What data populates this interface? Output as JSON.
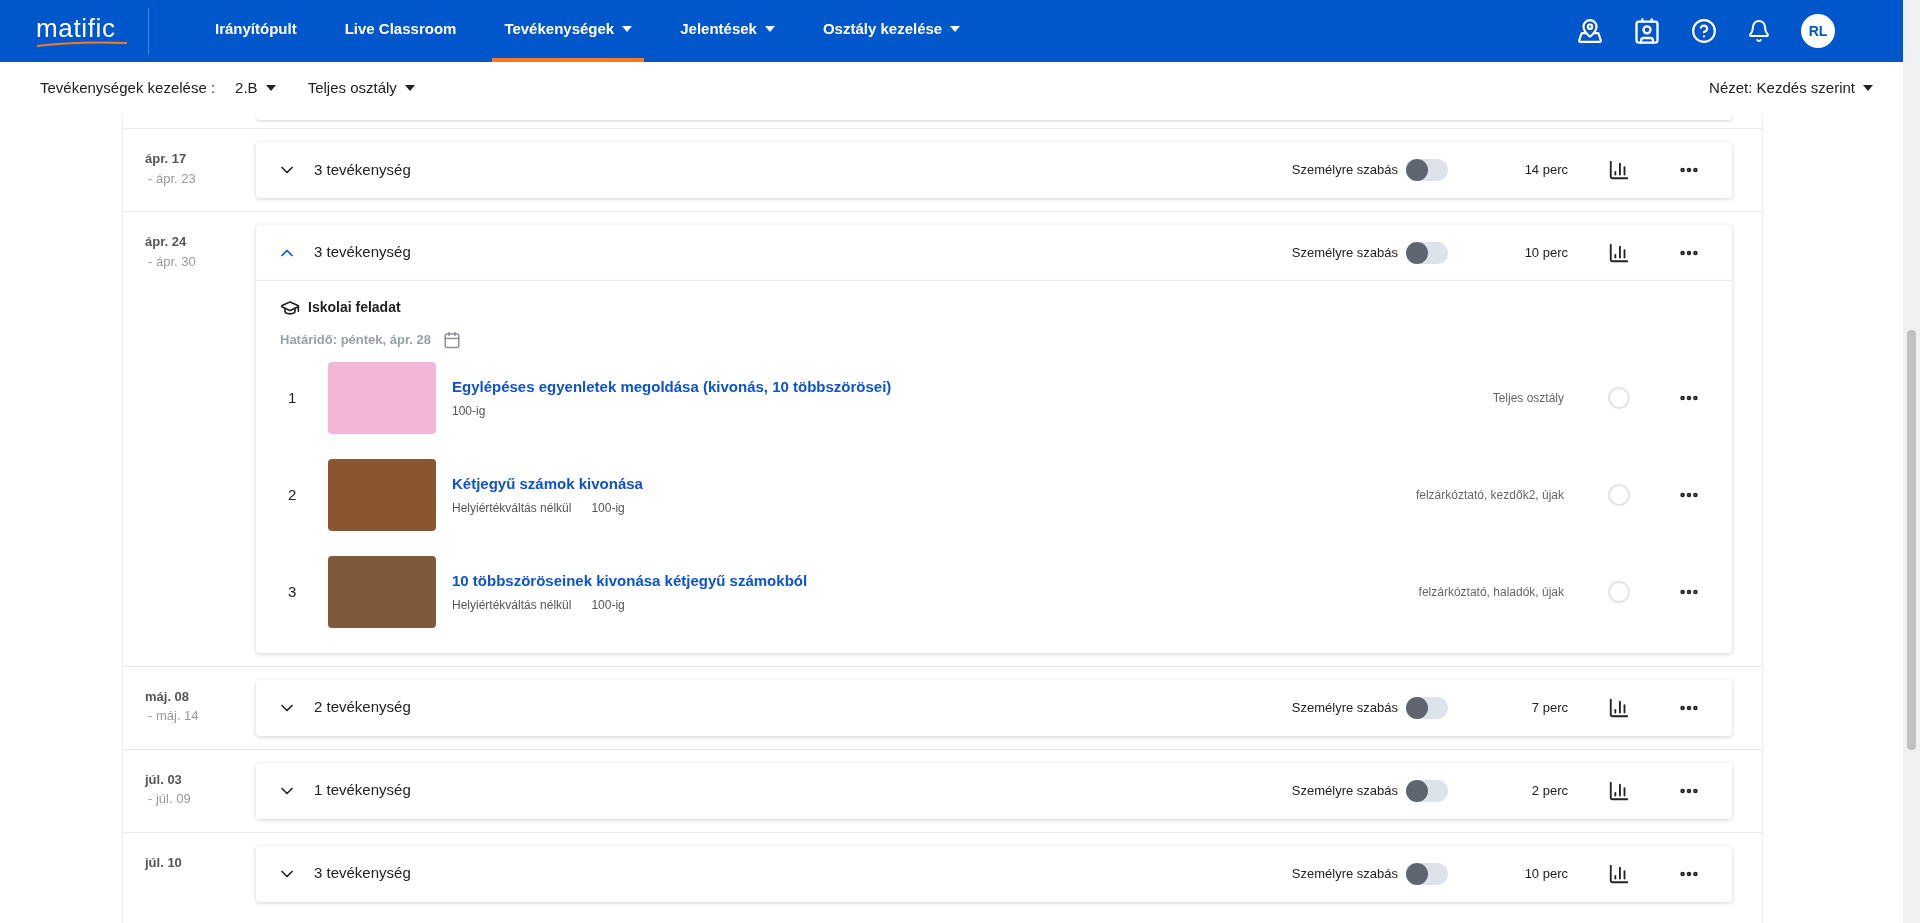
{
  "nav": {
    "logo": "matific",
    "items": [
      {
        "label": "Irányítópult",
        "dropdown": false,
        "selected": false
      },
      {
        "label": "Live Classroom",
        "dropdown": false,
        "selected": false
      },
      {
        "label": "Tevékenységek",
        "dropdown": true,
        "selected": true
      },
      {
        "label": "Jelentések",
        "dropdown": true,
        "selected": false
      },
      {
        "label": "Osztály kezelése",
        "dropdown": true,
        "selected": false
      }
    ],
    "avatar": "RL"
  },
  "subbar": {
    "label": "Tevékenységek kezelése :",
    "class": "2.B",
    "group": "Teljes osztály",
    "view": "Nézet: Kezdés szerint"
  },
  "weeks": [
    {
      "start": "ápr. 17",
      "end": "- ápr. 23",
      "count": "3 tevékenység",
      "expanded": false,
      "personalize_label": "Személyre szabás",
      "personalize_on": false,
      "duration": "14 perc"
    },
    {
      "start": "ápr. 24",
      "end": "- ápr. 30",
      "count": "3 tevékenység",
      "expanded": true,
      "personalize_label": "Személyre szabás",
      "personalize_on": false,
      "duration": "10 perc",
      "section": {
        "title": "Iskolai feladat",
        "deadline": "Határidő: péntek, ápr. 28",
        "activities": [
          {
            "number": "1",
            "title": "Egylépéses egyenletek megoldása (kivonás, 10 többszörösei)",
            "tags": [
              "100-ig"
            ],
            "assignees": "Teljes osztály",
            "completed": false,
            "color": "#f4b6d6"
          },
          {
            "number": "2",
            "title": "Kétjegyű számok kivonása",
            "tags": [
              "Helyiértékváltás nélkül",
              "100-ig"
            ],
            "assignees": "felzárkóztató, kezdők2, újak",
            "completed": false,
            "color": "#8a5530"
          },
          {
            "number": "3",
            "title": "10 többszöröseinek kivonása kétjegyű számokból",
            "tags": [
              "Helyiértékváltás nélkül",
              "100-ig"
            ],
            "assignees": "felzárkóztató, haladók, újak",
            "completed": false,
            "color": "#7e5a3a"
          }
        ]
      }
    },
    {
      "start": "máj. 08",
      "end": "- máj. 14",
      "count": "2 tevékenység",
      "expanded": false,
      "personalize_label": "Személyre szabás",
      "personalize_on": false,
      "duration": "7 perc"
    },
    {
      "start": "júl. 03",
      "end": "- júl. 09",
      "count": "1 tevékenység",
      "expanded": false,
      "personalize_label": "Személyre szabás",
      "personalize_on": false,
      "duration": "2 perc"
    },
    {
      "start": "júl. 10",
      "count": "3 tevékenység",
      "expanded": false,
      "personalize_label": "Személyre szabás",
      "personalize_on": false,
      "duration": "10 perc"
    }
  ]
}
